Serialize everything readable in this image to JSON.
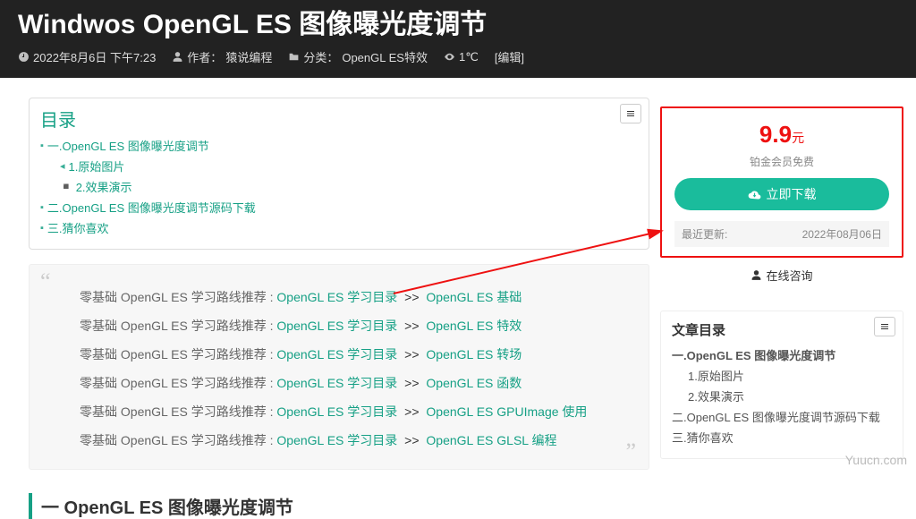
{
  "header": {
    "title": "Windwos OpenGL ES 图像曝光度调节",
    "date": "2022年8月6日 下午7:23",
    "author_label": "作者：",
    "author": "猿说编程",
    "category_label": "分类：",
    "category": "OpenGL ES特效",
    "views": "1℃",
    "edit": "[编辑]"
  },
  "toc": {
    "title": "目录",
    "items": [
      {
        "icon": "▪",
        "text": "一.OpenGL ES 图像曝光度调节"
      },
      {
        "icon": "◂",
        "text": "1.原始图片",
        "level": 2
      },
      {
        "icon": "◾",
        "text": "2.效果演示",
        "level": 2
      },
      {
        "icon": "▪",
        "text": "二.OpenGL ES 图像曝光度调节源码下载"
      },
      {
        "icon": "▪",
        "text": "三.猜你喜欢"
      }
    ]
  },
  "quote": {
    "prefix": "零基础 OpenGL ES 学习路线推荐 : ",
    "link1": "OpenGL ES 学习目录",
    "sep": " >> ",
    "targets": [
      "OpenGL ES 基础",
      "OpenGL ES 特效",
      "OpenGL ES 转场",
      "OpenGL ES 函数",
      "OpenGL ES GPUImage 使用",
      "OpenGL ES GLSL 编程"
    ]
  },
  "section_h2": "一 OpenGL ES 图像曝光度调节",
  "price_card": {
    "price": "9.9",
    "unit": "元",
    "vip": "铂金会员免费",
    "download": "立即下载",
    "update_label": "最近更新:",
    "update_value": "2022年08月06日",
    "consult": "在线咨询"
  },
  "side_toc": {
    "title": "文章目录",
    "items": [
      {
        "text": "一.OpenGL ES 图像曝光度调节",
        "bold": true
      },
      {
        "text": "1.原始图片",
        "level": 2
      },
      {
        "text": "2.效果演示",
        "level": 2
      },
      {
        "text": "二.OpenGL ES 图像曝光度调节源码下载"
      },
      {
        "text": "三.猜你喜欢"
      }
    ]
  },
  "watermark": "Yuucn.com"
}
